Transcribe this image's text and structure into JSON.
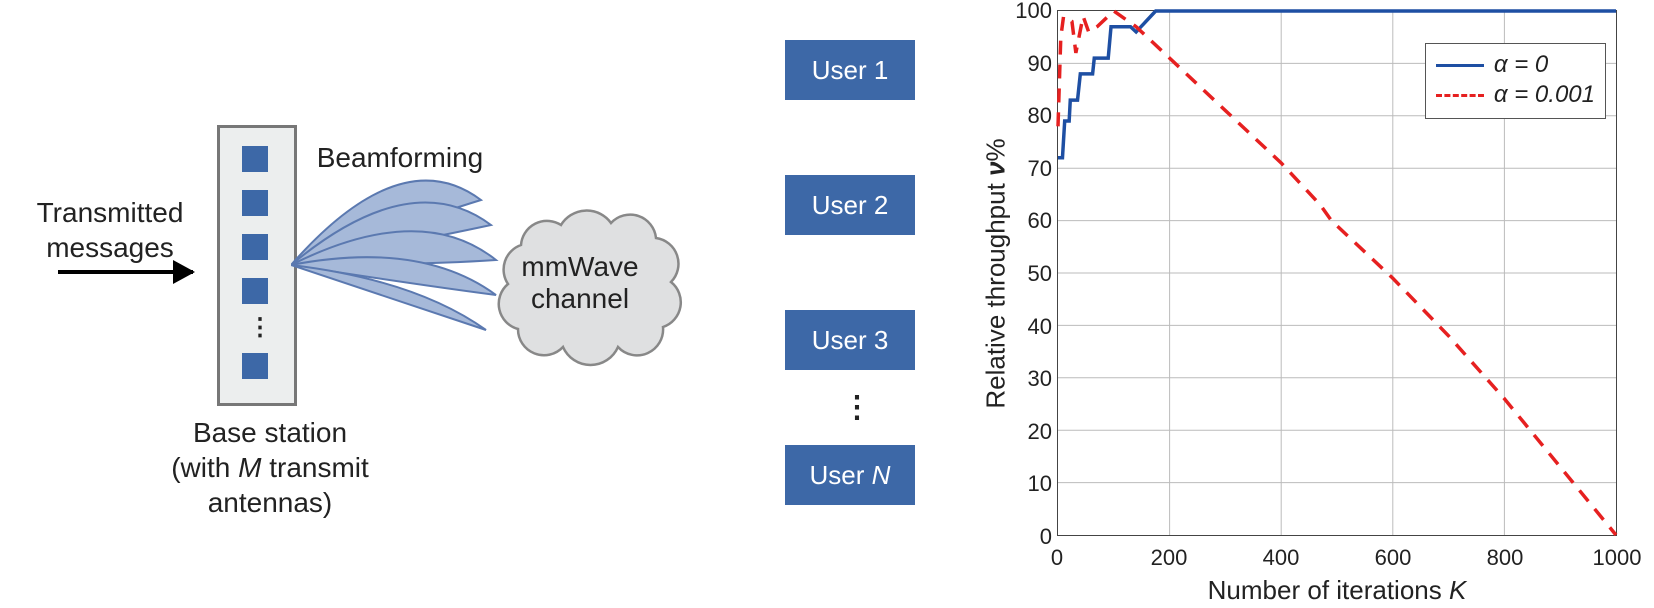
{
  "diagram": {
    "tx_label": "Transmitted\nmessages",
    "beamforming_label": "Beamforming",
    "cloud_label": "mmWave\nchannel",
    "bs_label_line1": "Base station",
    "bs_label_line2_pre": "(with ",
    "bs_label_line2_var": "M",
    "bs_label_line2_post": " transmit antennas)",
    "user_labels": [
      "User 1",
      "User 2",
      "User 3"
    ],
    "user_last_pre": "User ",
    "user_last_var": "N"
  },
  "chart_data": {
    "type": "line",
    "xlabel_pre": "Number of iterations ",
    "xlabel_var": "K",
    "ylabel_pre": "Relative throughput ",
    "ylabel_var": "ν",
    "ylabel_post": "%",
    "xlim": [
      0,
      1000
    ],
    "ylim": [
      0,
      100
    ],
    "xticks": [
      0,
      200,
      400,
      600,
      800,
      1000
    ],
    "yticks": [
      0,
      10,
      20,
      30,
      40,
      50,
      60,
      70,
      80,
      90,
      100
    ],
    "legend": {
      "a0": "α = 0",
      "a1": "α = 0.001"
    },
    "series": [
      {
        "name": "alpha0",
        "style": "solid-blue",
        "x": [
          0,
          8,
          12,
          20,
          22,
          35,
          40,
          62,
          65,
          90,
          95,
          130,
          140,
          175,
          1000
        ],
        "y": [
          72,
          72,
          79,
          79,
          83,
          83,
          88,
          88,
          91,
          91,
          97,
          97,
          96,
          100,
          100
        ]
      },
      {
        "name": "alpha0001",
        "style": "dash-red",
        "x": [
          0,
          5,
          10,
          25,
          32,
          45,
          55,
          70,
          100,
          140,
          200,
          300,
          400,
          470,
          490,
          600,
          700,
          800,
          900,
          1000
        ],
        "y": [
          78,
          95,
          99,
          98,
          92,
          99,
          96,
          97,
          100,
          97,
          91,
          81,
          71,
          63,
          60,
          49,
          38,
          26,
          13,
          0
        ]
      }
    ]
  }
}
